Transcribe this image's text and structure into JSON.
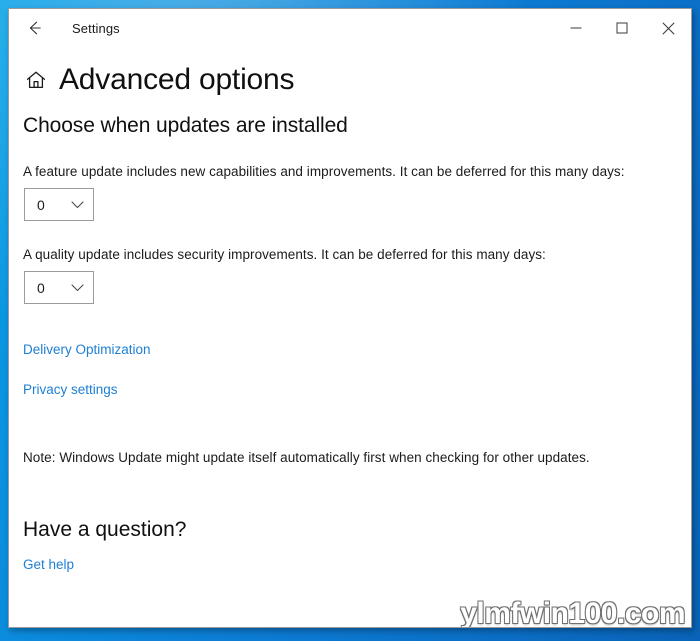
{
  "window": {
    "title": "Settings",
    "back_icon": "back-arrow-icon",
    "controls": {
      "minimize": "minimize-icon",
      "maximize": "maximize-icon",
      "close": "close-icon"
    }
  },
  "page": {
    "home_icon": "home-icon",
    "title": "Advanced options",
    "section_title": "Choose when updates are installed",
    "feature_update": {
      "description": "A feature update includes new capabilities and improvements. It can be deferred for this many days:",
      "dropdown_value": "0",
      "dropdown_icon": "chevron-down-icon"
    },
    "quality_update": {
      "description": "A quality update includes security improvements. It can be deferred for this many days:",
      "dropdown_value": "0",
      "dropdown_icon": "chevron-down-icon"
    },
    "links": {
      "delivery_optimization": "Delivery Optimization",
      "privacy_settings": "Privacy settings"
    },
    "note": "Note: Windows Update might update itself automatically first when checking for other updates.",
    "question": {
      "title": "Have a question?",
      "get_help": "Get help"
    }
  },
  "watermark": {
    "text": "ylmfwin100.com"
  },
  "colors": {
    "link": "#1e7fd4",
    "desktop": "#0b7ad2",
    "text": "#1b1b1b",
    "border": "#9b9b9b"
  }
}
